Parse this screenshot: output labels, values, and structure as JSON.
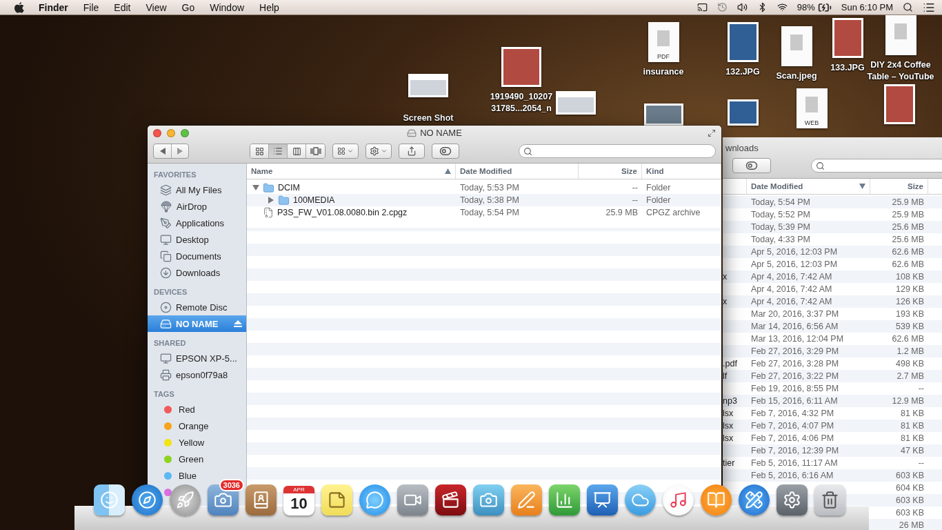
{
  "menu_bar": {
    "app": "Finder",
    "menus": [
      "File",
      "Edit",
      "View",
      "Go",
      "Window",
      "Help"
    ],
    "battery_percent": "98%",
    "clock": "Sun 6:10 PM"
  },
  "desktop_icons": [
    {
      "kind": "screenshot",
      "label": [
        "Screen Shot"
      ]
    },
    {
      "kind": "photo",
      "label": [
        "1919490_10207",
        "31785...2054_n"
      ]
    },
    {
      "kind": "screenshot"
    },
    {
      "kind": "pdf",
      "badge": "PDF",
      "label": [
        "insurance"
      ]
    },
    {
      "kind": "photo",
      "label": [
        "132.JPG"
      ]
    },
    {
      "kind": "document",
      "label": [
        "Scan.jpeg"
      ]
    },
    {
      "kind": "photo",
      "label": [
        "133.JPG"
      ]
    },
    {
      "kind": "document",
      "label": [
        "DIY 2x4 Coffee",
        "Table – YouTube"
      ]
    },
    {
      "kind": "photo"
    },
    {
      "kind": "photo"
    },
    {
      "kind": "web",
      "badge": "WEB"
    },
    {
      "kind": "photo"
    }
  ],
  "background_window": {
    "title": "wnloads",
    "columns": [
      {
        "label": "Date Modified",
        "sorted": true,
        "ascending": false
      },
      {
        "label": "Size",
        "sorted": false
      }
    ],
    "rows": [
      {
        "date": "Today, 5:54 PM",
        "size": "25.9 MB"
      },
      {
        "date": "Today, 5:52 PM",
        "size": "25.9 MB"
      },
      {
        "date": "Today, 5:39 PM",
        "size": "25.6 MB"
      },
      {
        "date": "Today, 4:33 PM",
        "size": "25.6 MB"
      },
      {
        "date": "Apr 5, 2016, 12:03 PM",
        "size": "62.6 MB"
      },
      {
        "date": "Apr 5, 2016, 12:03 PM",
        "size": "62.6 MB"
      },
      {
        "name": "x",
        "date": "Apr 4, 2016, 7:42 AM",
        "size": "108 KB"
      },
      {
        "date": "Apr 4, 2016, 7:42 AM",
        "size": "129 KB"
      },
      {
        "name": "x",
        "date": "Apr 4, 2016, 7:42 AM",
        "size": "126 KB"
      },
      {
        "date": "Mar 20, 2016, 3:37 PM",
        "size": "193 KB"
      },
      {
        "date": "Mar 14, 2016, 6:56 AM",
        "size": "539 KB"
      },
      {
        "date": "Mar 13, 2016, 12:04 PM",
        "size": "62.6 MB"
      },
      {
        "date": "Feb 27, 2016, 3:29 PM",
        "size": "1.2 MB"
      },
      {
        "name": ".pdf",
        "date": "Feb 27, 2016, 3:28 PM",
        "size": "498 KB"
      },
      {
        "name": "lf",
        "date": "Feb 27, 2016, 3:22 PM",
        "size": "2.7 MB"
      },
      {
        "date": "Feb 19, 2016, 8:55 PM",
        "size": "--"
      },
      {
        "name": "np3",
        "date": "Feb 15, 2016, 6:11 AM",
        "size": "12.9 MB"
      },
      {
        "name": "lsx",
        "date": "Feb 7, 2016, 4:32 PM",
        "size": "81 KB"
      },
      {
        "name": "lsx",
        "date": "Feb 7, 2016, 4:07 PM",
        "size": "81 KB"
      },
      {
        "name": "lsx",
        "date": "Feb 7, 2016, 4:06 PM",
        "size": "81 KB"
      },
      {
        "date": "Feb 7, 2016, 12:39 PM",
        "size": "47 KB"
      },
      {
        "name": "tier",
        "date": "Feb 5, 2016, 11:17 AM",
        "size": "--"
      },
      {
        "date": "Feb 5, 2016, 6:16 AM",
        "size": "603 KB"
      },
      {
        "size": "604 KB"
      },
      {
        "size": "603 KB"
      },
      {
        "size": "603 KB"
      },
      {
        "size": "26 MB"
      }
    ]
  },
  "finder": {
    "title": "NO NAME",
    "view_modes": [
      {
        "kind": "icons",
        "selected": false
      },
      {
        "kind": "list",
        "selected": true
      },
      {
        "kind": "columns",
        "selected": false
      },
      {
        "kind": "coverflow",
        "selected": false
      }
    ],
    "sidebar": [
      {
        "heading": "FAVORITES",
        "items": [
          {
            "kind": "files",
            "label": "All My Files",
            "selected": false
          },
          {
            "kind": "airdrop",
            "label": "AirDrop",
            "selected": false
          },
          {
            "kind": "applications",
            "label": "Applications",
            "selected": false
          },
          {
            "kind": "desktop",
            "label": "Desktop",
            "selected": false
          },
          {
            "kind": "documents",
            "label": "Documents",
            "selected": false
          },
          {
            "kind": "downloads",
            "label": "Downloads",
            "selected": false
          }
        ]
      },
      {
        "heading": "DEVICES",
        "items": [
          {
            "kind": "disc",
            "label": "Remote Disc",
            "selected": false
          },
          {
            "kind": "drive",
            "label": "NO NAME",
            "selected": true
          }
        ]
      },
      {
        "heading": "SHARED",
        "items": [
          {
            "kind": "display",
            "label": "EPSON XP-5...",
            "selected": false
          },
          {
            "kind": "printer",
            "label": "epson0f79a8",
            "selected": false
          }
        ]
      },
      {
        "heading": "TAGS",
        "items": [
          {
            "kind": "tag",
            "label": "Red",
            "color": "#f25a5a",
            "selected": false
          },
          {
            "kind": "tag",
            "label": "Orange",
            "color": "#f7a21b",
            "selected": false
          },
          {
            "kind": "tag",
            "label": "Yellow",
            "color": "#f3e312",
            "selected": false
          },
          {
            "kind": "tag",
            "label": "Green",
            "color": "#8fd321",
            "selected": false
          },
          {
            "kind": "tag",
            "label": "Blue",
            "color": "#5cb8f2",
            "selected": false
          },
          {
            "kind": "tag",
            "color": "#d96fe0",
            "selected": false
          }
        ]
      }
    ],
    "columns": [
      {
        "label": "Name",
        "sorted": true,
        "ascending": true
      },
      {
        "label": "Date Modified",
        "sorted": false
      },
      {
        "label": "Size",
        "sorted": false
      },
      {
        "label": "Kind",
        "sorted": false
      }
    ],
    "rows": [
      {
        "kind": "folder",
        "name": "DCIM",
        "date": "Today, 5:53 PM",
        "size": "--",
        "type": "Folder",
        "expanded": true,
        "children": [
          {
            "kind": "folder",
            "name": "100MEDIA",
            "date": "Today, 5:38 PM",
            "size": "--",
            "type": "Folder",
            "expanded": false
          }
        ]
      },
      {
        "kind": "archive",
        "name": "P3S_FW_V01.08.0080.bin 2.cpgz",
        "date": "Today, 5:54 PM",
        "size": "25.9 MB",
        "type": "CPGZ archive"
      }
    ]
  },
  "dock": [
    {
      "kind": "finder"
    },
    {
      "kind": "safari"
    },
    {
      "kind": "launchpad"
    },
    {
      "kind": "mail",
      "badge": "3036"
    },
    {
      "kind": "contacts"
    },
    {
      "kind": "calendar",
      "month": "APR",
      "day": "10"
    },
    {
      "kind": "notes"
    },
    {
      "kind": "messages"
    },
    {
      "kind": "facetime"
    },
    {
      "kind": "photobooth"
    },
    {
      "kind": "iphoto"
    },
    {
      "kind": "pages"
    },
    {
      "kind": "numbers"
    },
    {
      "kind": "keynote"
    },
    {
      "kind": "icloud"
    },
    {
      "kind": "itunes"
    },
    {
      "kind": "ibooks"
    },
    {
      "kind": "appstore"
    },
    {
      "kind": "preferences"
    },
    {
      "kind": "trash"
    }
  ]
}
